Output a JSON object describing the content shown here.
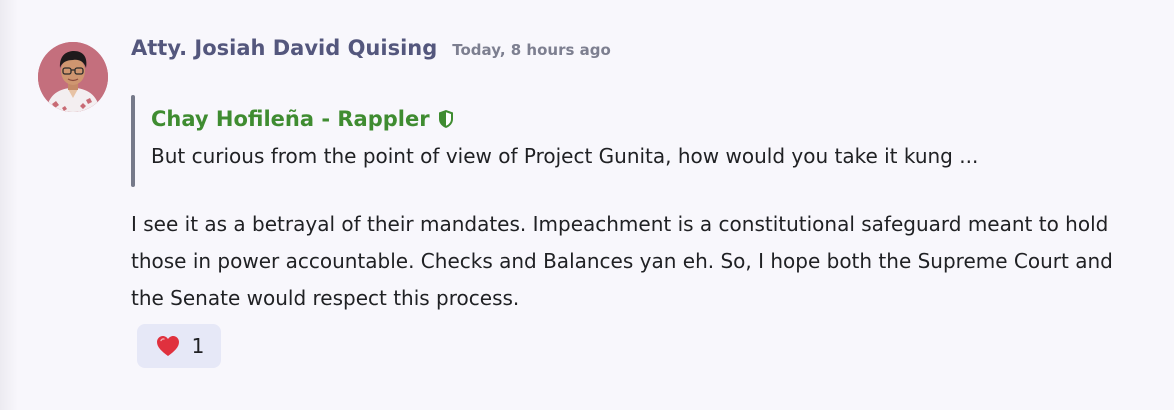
{
  "message": {
    "author": "Atty. Josiah David Quising",
    "timestamp": "Today, 8 hours ago",
    "quoted": {
      "author": "Chay Hofileña - Rappler",
      "text": "But curious from the point of view of Project Gunita, how would you take it kung ..."
    },
    "body": "I see it as a betrayal of their mandates. Impeachment is a constitutional safeguard meant to hold those in power accountable. Checks and Balances yan eh. So, I hope both the Supreme Court and the Senate would respect this process.",
    "reactions": [
      {
        "icon": "heart-icon",
        "count": "1"
      }
    ]
  },
  "colors": {
    "author": "#54577d",
    "timestamp": "#7d7f90",
    "quoted_author": "#3f8c31",
    "quote_bar": "#767a8a",
    "reaction_bg": "#e6e8f7",
    "heart": "#e0313e"
  }
}
